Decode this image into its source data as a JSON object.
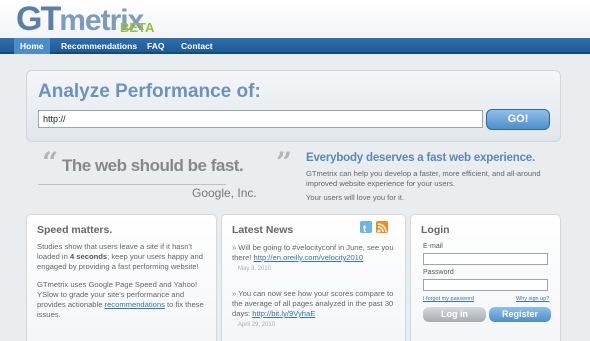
{
  "header": {
    "logo_gt": "GT",
    "logo_metrix": "metrix",
    "logo_beta": "BETA"
  },
  "nav": {
    "items": [
      {
        "label": "Home",
        "active": true
      },
      {
        "label": "Recommendations",
        "active": false
      },
      {
        "label": "FAQ",
        "active": false
      },
      {
        "label": "Contact",
        "active": false
      }
    ]
  },
  "analyze": {
    "title": "Analyze Performance of:",
    "url_value": "http://",
    "go_label": "GO!"
  },
  "quote": {
    "open_mark": "“",
    "text": "The web should be fast.",
    "close_mark": "”",
    "author": "Google, Inc."
  },
  "tagline": {
    "title": "Everybody deserves a fast web experience.",
    "body": "GTmetrix can help you develop a faster, more efficient, and all-around improved website experience for your users.",
    "extra": "Your users will love you for it."
  },
  "speed": {
    "title": "Speed matters.",
    "p1_before": "Studies show that users leave a site if it hasn't loaded in ",
    "p1_bold": "4 seconds",
    "p1_after": "; keep your users happy and engaged by providing a fast performing website!",
    "p2_before": "GTmetrix uses Google Page Speed and Yahoo! YSlow to grade your site's performance and provides actionable ",
    "p2_link": "recommendations",
    "p2_after": " to fix these issues."
  },
  "news": {
    "title": "Latest News",
    "twitter_icon": "twitter-icon",
    "rss_icon": "rss-icon",
    "items": [
      {
        "text": "Will be going to #velocityconf in June, see you there! ",
        "link": "http://en.oreilly.com/velocity2010",
        "date": "May 3, 2010"
      },
      {
        "text": "You can now see how your scores compare to the average of all pages analyzed in the past 30 days: ",
        "link": "http://bit.ly/9VyhaE",
        "date": "April 29, 2010"
      }
    ]
  },
  "login": {
    "title": "Login",
    "email_label": "E-mail",
    "password_label": "Password",
    "forgot_link": "I forgot my password",
    "why_link": "Why sign up?",
    "login_button": "Log in",
    "register_button": "Register"
  },
  "colors": {
    "brand_blue": "#5b7fa8",
    "beta_green": "#97c03c",
    "nav_blue": "#1f5b96"
  }
}
